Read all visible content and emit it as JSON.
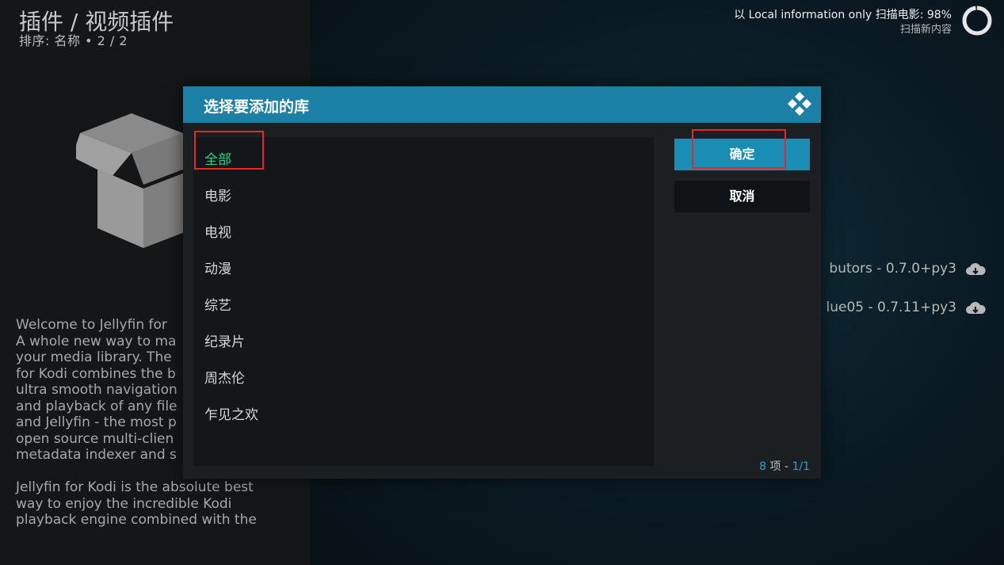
{
  "header": {
    "title": "插件 / 视频插件",
    "sort": "排序: 名称  •  2 / 2"
  },
  "scan": {
    "line1": "以 Local information only 扫描电影: 98%",
    "line2": "扫描新内容",
    "progress": 0.98
  },
  "addon": {
    "description": "Welcome to Jellyfin for\nA whole new way to ma\nyour media library. The\nfor Kodi combines the b\nultra smooth navigation\nand playback of any file\nand Jellyfin - the most p\nopen source multi-clien\nmetadata indexer and s\n\nJellyfin for Kodi is the absolute best\nway to enjoy the incredible Kodi\nplayback engine combined with the",
    "rows": [
      "butors - 0.7.0+py3",
      "lue05 - 0.7.11+py3"
    ]
  },
  "dialog": {
    "title": "选择要添加的库",
    "items": [
      "全部",
      "电影",
      "电视",
      "动漫",
      "综艺",
      "纪录片",
      "周杰伦",
      "乍见之欢"
    ],
    "selected_index": 0,
    "ok_label": "确定",
    "cancel_label": "取消",
    "count_num": "8",
    "count_mid": " 项 - ",
    "count_page": "1/1"
  },
  "colors": {
    "accent": "#1c7fa6",
    "selected_text": "#2bd28b",
    "highlight": "#e8262a"
  }
}
